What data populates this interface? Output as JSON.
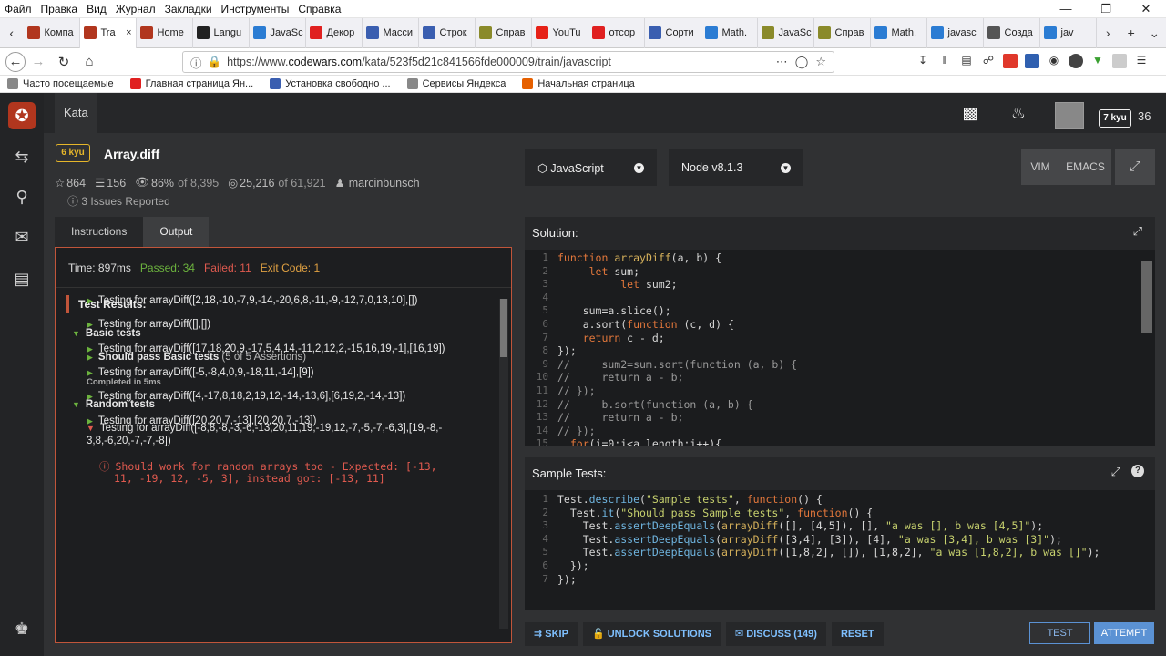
{
  "menu": [
    "Файл",
    "Правка",
    "Вид",
    "Журнал",
    "Закладки",
    "Инструменты",
    "Справка"
  ],
  "tabs": [
    {
      "label": "Компа",
      "color": "#b1361e"
    },
    {
      "label": "Tra",
      "color": "#b1361e",
      "active": true
    },
    {
      "label": "Home",
      "color": "#b1361e"
    },
    {
      "label": "Langu",
      "color": "#222222"
    },
    {
      "label": "JavaSc",
      "color": "#2b7cd3"
    },
    {
      "label": "Декор",
      "color": "#e02020"
    },
    {
      "label": "Масси",
      "color": "#3a5eb0"
    },
    {
      "label": "Строк",
      "color": "#3a5eb0"
    },
    {
      "label": "Справ",
      "color": "#8a8a2a"
    },
    {
      "label": "YouTu",
      "color": "#e62117"
    },
    {
      "label": "отсор",
      "color": "#e02020"
    },
    {
      "label": "Сорти",
      "color": "#3a5eb0"
    },
    {
      "label": "Math.",
      "color": "#2b7cd3"
    },
    {
      "label": "JavaSc",
      "color": "#8a8a2a"
    },
    {
      "label": "Справ",
      "color": "#8a8a2a"
    },
    {
      "label": "Math.",
      "color": "#2b7cd3"
    },
    {
      "label": "javasc",
      "color": "#2b7cd3"
    },
    {
      "label": "Созда",
      "color": "#555555"
    },
    {
      "label": "jav",
      "color": "#2b7cd3"
    }
  ],
  "url": {
    "prefix": "https://www.",
    "domain": "codewars.com",
    "path": "/kata/523f5d21c841566fde000009/train/javascript"
  },
  "bookmarks": [
    {
      "label": "Часто посещаемые",
      "color": "#888888"
    },
    {
      "label": "Главная страница Ян...",
      "color": "#e02020"
    },
    {
      "label": "Установка свободно ...",
      "color": "#3a5eb0"
    },
    {
      "label": "Сервисы Яндекса",
      "color": "#888888"
    },
    {
      "label": "Начальная страница",
      "color": "#e66000"
    }
  ],
  "top": {
    "kata_link": "Kata",
    "rank": "7 kyu",
    "honor": "36"
  },
  "kata": {
    "kyu": "6 kyu",
    "title": "Array.diff",
    "stars": "864",
    "collections": "156",
    "satisfaction": "86%",
    "satisfaction_of": "of 8,395",
    "completed": "25,216",
    "completed_of": "of 61,921",
    "author": "marcinbunsch",
    "issues": "3 Issues Reported"
  },
  "language": "JavaScript",
  "runtime": "Node v8.1.3",
  "keybind": {
    "vim": "VIM",
    "emacs": "EMACS"
  },
  "left_tabs": {
    "instructions": "Instructions",
    "output": "Output"
  },
  "output": {
    "time": "Time: 897ms",
    "passed": "Passed: 34",
    "failed": "Failed: 11",
    "exit": "Exit Code: 1",
    "results_title": "Test Results:",
    "basic": "Basic tests",
    "basic_pass": "Should pass Basic tests",
    "basic_pass_count": "(5 of 5 Assertions)",
    "completed": "Completed in 5ms",
    "random": "Random tests",
    "fail_test_1": "Testing for arrayDiff([-8,8,-8,-3,-6,-13,20,11,19,-19,12,-7,-5,-7,-6,3],[19,-8,-",
    "fail_test_2": "3,8,-6,20,-7,-7,-8])",
    "error_1": "Should work for random arrays too - Expected: [-13,",
    "error_2": "11, -19, 12, -5, 3], instead got: [-13, 11]",
    "tests": [
      "Testing for arrayDiff([2,18,-10,-7,9,-14,-20,6,8,-11,-9,-12,7,0,13,10],[])",
      "Testing for arrayDiff([],[])",
      "Testing for arrayDiff([17,18,20,9,-17,5,4,14,-11,2,12,2,-15,16,19,-1],[16,19])",
      "Testing for arrayDiff([-5,-8,4,0,9,-18,11,-14],[9])",
      "Testing for arrayDiff([4,-17,8,18,2,19,12,-14,-13,6],[6,19,2,-14,-13])",
      "Testing for arrayDiff([20,20,7,-13],[20,20,7,-13])"
    ]
  },
  "solution": {
    "title": "Solution:",
    "line_numbers": [
      "1",
      "2",
      "3",
      "4",
      "5",
      "6",
      "7",
      "8",
      "9",
      "10",
      "11",
      "12",
      "13",
      "14",
      "15"
    ],
    "lines": [
      "function arrayDiff(a, b) {",
      "     let sum;",
      "          let sum2;",
      "",
      "    sum=a.slice();",
      "    a.sort(function (c, d) {",
      "    return c - d;",
      "});",
      "//     sum2=sum.sort(function (a, b) {",
      "//     return a - b;",
      "// });",
      "//     b.sort(function (a, b) {",
      "//     return a - b;",
      "// });",
      "  for(i=0;i<a.length;i++){"
    ]
  },
  "sample": {
    "title": "Sample Tests:",
    "line_numbers": [
      "1",
      "2",
      "3",
      "4",
      "5",
      "6",
      "7"
    ],
    "lines": [
      "Test.describe(\"Sample tests\", function() {",
      "  Test.it(\"Should pass Sample tests\", function() {",
      "    Test.assertDeepEquals(arrayDiff([], [4,5]), [], \"a was [], b was [4,5]\");",
      "    Test.assertDeepEquals(arrayDiff([3,4], [3]), [4], \"a was [3,4], b was [3]\");",
      "    Test.assertDeepEquals(arrayDiff([1,8,2], []), [1,8,2], \"a was [1,8,2], b was []\");",
      "  });",
      "});"
    ]
  },
  "actions": {
    "skip": "SKIP",
    "unlock": "UNLOCK SOLUTIONS",
    "discuss": "DISCUSS (149)",
    "reset": "RESET",
    "test": "TEST",
    "attempt": "ATTEMPT"
  }
}
